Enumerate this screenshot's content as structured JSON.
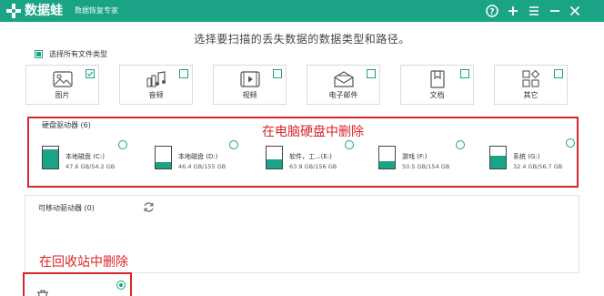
{
  "titlebar": {
    "app_name": "数据蛙",
    "subtitle": "数据恢复专家",
    "icons": [
      "help-icon",
      "plus-icon",
      "menu-icon",
      "minimize-icon",
      "close-icon"
    ],
    "color": "#1aa385"
  },
  "instruction": "选择要扫描的丢失数据的数据类型和路径。",
  "select_all": {
    "label": "选择所有文件类型",
    "checked": true
  },
  "file_types": [
    {
      "label": "图片",
      "icon": "image-icon",
      "checked": true
    },
    {
      "label": "音频",
      "icon": "audio-icon",
      "checked": false
    },
    {
      "label": "视频",
      "icon": "video-icon",
      "checked": false
    },
    {
      "label": "电子邮件",
      "icon": "email-icon",
      "checked": false
    },
    {
      "label": "文档",
      "icon": "document-icon",
      "checked": false
    },
    {
      "label": "其它",
      "icon": "other-icon",
      "checked": false
    }
  ],
  "hard_drives": {
    "title": "硬盘驱动器 (6)",
    "annotation": "在电脑硬盘中删除",
    "drives": [
      {
        "name": "本地磁盘 (C:)",
        "size": "47.6 GB/54.2 GB",
        "used_fraction": 0.87,
        "selected": false
      },
      {
        "name": "本地磁盘 (D:)",
        "size": "46.4 GB/155 GB",
        "used_fraction": 0.3,
        "selected": false
      },
      {
        "name": "软件，工...(E:)",
        "size": "63.9 GB/156 GB",
        "used_fraction": 0.41,
        "selected": false
      },
      {
        "name": "游戏 (F:)",
        "size": "50.5 GB/154 GB",
        "used_fraction": 0.33,
        "selected": false
      },
      {
        "name": "系统 (G:)",
        "size": "32.4 GB/56.7 GB",
        "used_fraction": 0.57,
        "selected": false
      }
    ]
  },
  "removable": {
    "title": "可移动驱动器 (0)",
    "refresh_icon": "refresh-icon"
  },
  "recycle": {
    "annotation": "在回收站中删除",
    "selected": true,
    "icon": "recycle-bin-icon"
  },
  "accent": "#1aa385",
  "annotation_color": "#d9262a"
}
